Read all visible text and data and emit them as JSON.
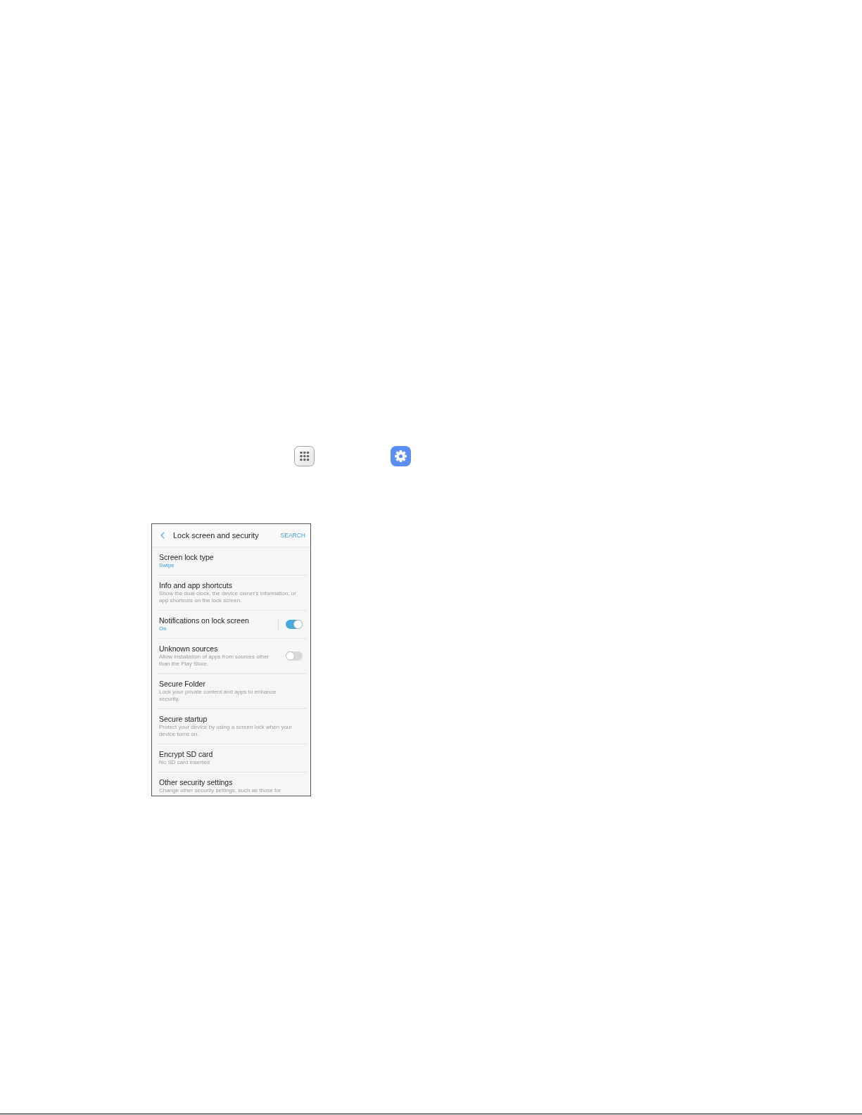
{
  "settings_screen": {
    "title": "Lock screen and security",
    "action": "SEARCH",
    "items": [
      {
        "kind": "entry",
        "title": "Screen lock type",
        "value": "Swipe"
      },
      {
        "kind": "entry",
        "title": "Info and app shortcuts",
        "description": "Show the dual clock, the device owner's information, or app shortcuts on the lock screen."
      },
      {
        "kind": "split",
        "title": "Notifications on lock screen",
        "value": "On",
        "on": true
      },
      {
        "kind": "switch",
        "title": "Unknown sources",
        "description": "Allow installation of apps from sources other than the Play Store.",
        "on": false
      },
      {
        "kind": "entry",
        "title": "Secure Folder",
        "description": "Lock your private content and apps to enhance security."
      },
      {
        "kind": "entry",
        "title": "Secure startup",
        "description": "Protect your device by using a screen lock when your device turns on."
      },
      {
        "kind": "entry",
        "title": "Encrypt SD card",
        "description": "No SD card inserted"
      },
      {
        "kind": "entry",
        "title": "Other security settings",
        "description": "Change other security settings, such as those for"
      }
    ]
  }
}
